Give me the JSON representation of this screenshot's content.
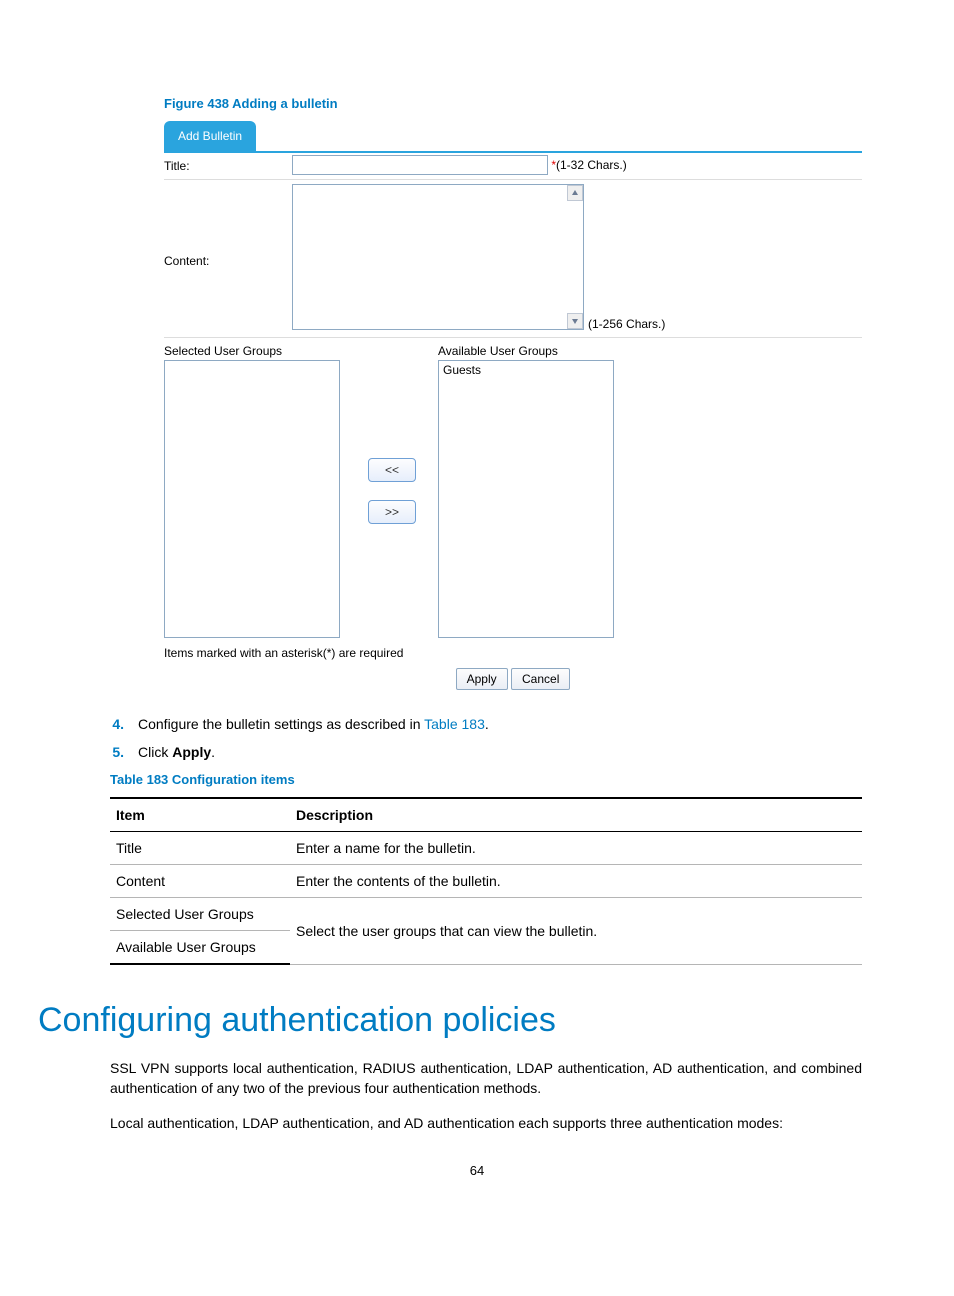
{
  "figure": {
    "caption": "Figure 438 Adding a bulletin",
    "tab_label": "Add Bulletin",
    "title_label": "Title:",
    "title_value": "",
    "title_hint_star": "*",
    "title_hint": "(1-32 Chars.)",
    "content_label": "Content:",
    "content_value": "",
    "content_hint": "(1-256 Chars.)",
    "selected_groups_label": "Selected User Groups",
    "available_groups_label": "Available User Groups",
    "selected_groups": [],
    "available_groups": [
      "Guests"
    ],
    "move_left_label": "<<",
    "move_right_label": ">>",
    "required_note": "Items marked with an asterisk(*) are required",
    "apply_label": "Apply",
    "cancel_label": "Cancel"
  },
  "steps": {
    "s4_num": "4.",
    "s4_text_a": "Configure the bulletin settings as described in ",
    "s4_link": "Table 183",
    "s4_text_b": ".",
    "s5_num": "5.",
    "s5_text_a": "Click ",
    "s5_bold": "Apply",
    "s5_text_b": "."
  },
  "table": {
    "caption": "Table 183 Configuration items",
    "head_item": "Item",
    "head_desc": "Description",
    "rows": {
      "r1_item": "Title",
      "r1_desc": "Enter a name for the bulletin.",
      "r2_item": "Content",
      "r2_desc": "Enter the contents of the bulletin.",
      "r3_item": "Selected User Groups",
      "r4_item": "Available User Groups",
      "r34_desc": "Select the user groups that can view the bulletin."
    }
  },
  "section": {
    "heading": "Configuring authentication policies",
    "p1": "SSL VPN supports local authentication, RADIUS authentication, LDAP authentication, AD authentication, and combined authentication of any two of the previous four authentication methods.",
    "p2": "Local authentication, LDAP authentication, and AD authentication each supports three authentication modes:"
  },
  "page_number": "64"
}
